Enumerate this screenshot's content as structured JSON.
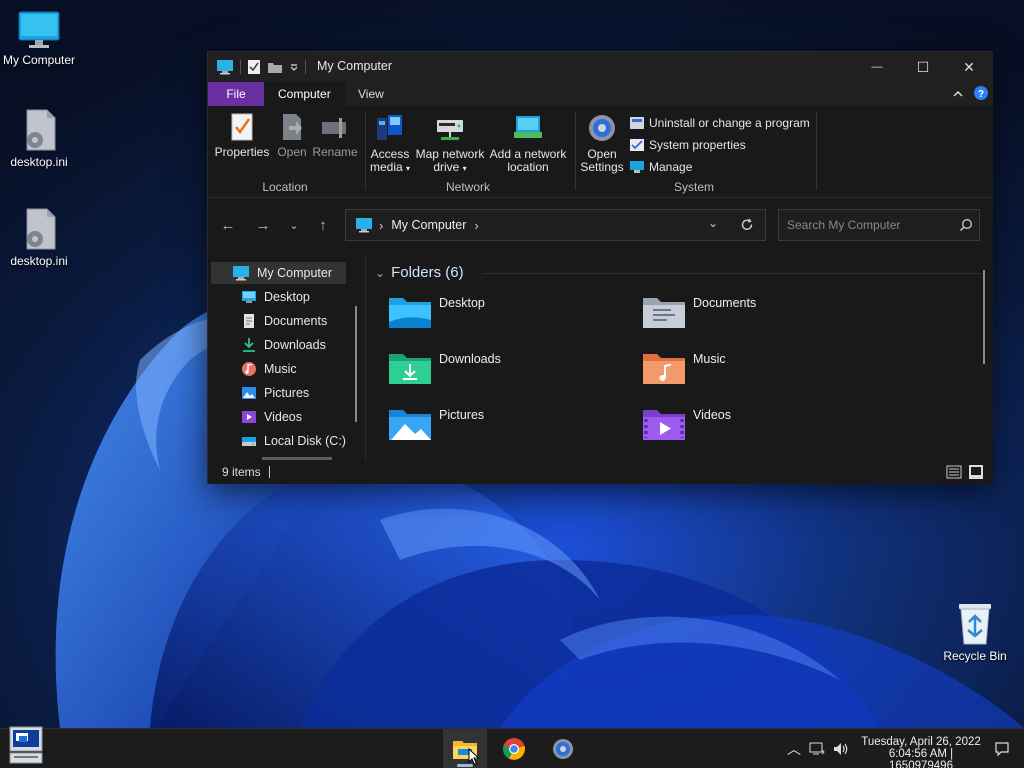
{
  "desktop": {
    "icons": [
      {
        "label": "My Computer",
        "icon": "monitor-icon"
      },
      {
        "label": "desktop.ini",
        "icon": "settings-file-icon"
      },
      {
        "label": "desktop.ini",
        "icon": "settings-file-icon"
      },
      {
        "label": "Recycle Bin",
        "icon": "recycle-bin-icon"
      }
    ]
  },
  "window": {
    "title": "My Computer",
    "controls": {
      "minimize": "—",
      "maximize": "☐",
      "close": "✕"
    },
    "ribbon_tabs": [
      "File",
      "Computer",
      "View"
    ],
    "active_tab": "Computer",
    "ribbon": {
      "location": {
        "label": "Location",
        "buttons": [
          "Properties",
          "Open",
          "Rename"
        ]
      },
      "network": {
        "label": "Network",
        "access_media": [
          "Access",
          "media"
        ],
        "map_network": [
          "Map network",
          "drive"
        ],
        "add_location": [
          "Add a network",
          "location"
        ]
      },
      "system": {
        "label": "System",
        "open_settings": [
          "Open",
          "Settings"
        ],
        "items": [
          "Uninstall or change a program",
          "System properties",
          "Manage"
        ]
      }
    },
    "address": {
      "path": "My Computer",
      "search_placeholder": "Search My Computer"
    },
    "nav_pane": {
      "items": [
        {
          "label": "My Computer",
          "icon": "monitor-icon",
          "selected": true
        },
        {
          "label": "Desktop",
          "icon": "desktop-icon"
        },
        {
          "label": "Documents",
          "icon": "documents-icon"
        },
        {
          "label": "Downloads",
          "icon": "download-icon"
        },
        {
          "label": "Music",
          "icon": "music-icon"
        },
        {
          "label": "Pictures",
          "icon": "pictures-icon"
        },
        {
          "label": "Videos",
          "icon": "videos-icon"
        },
        {
          "label": "Local Disk (C:)",
          "icon": "drive-icon"
        }
      ]
    },
    "content": {
      "group_title": "Folders (6)",
      "folders": [
        {
          "label": "Desktop",
          "icon": "desktop-folder-icon"
        },
        {
          "label": "Documents",
          "icon": "documents-folder-icon"
        },
        {
          "label": "Downloads",
          "icon": "downloads-folder-icon"
        },
        {
          "label": "Music",
          "icon": "music-folder-icon"
        },
        {
          "label": "Pictures",
          "icon": "pictures-folder-icon"
        },
        {
          "label": "Videos",
          "icon": "videos-folder-icon"
        }
      ]
    },
    "status": {
      "item_count": "9 items"
    }
  },
  "taskbar": {
    "apps": [
      "file-explorer-icon",
      "chrome-icon",
      "settings-icon"
    ],
    "active_app": "file-explorer-icon",
    "clock": {
      "date": "Tuesday, April 26, 2022",
      "time": "6:04:56 AM | 1650979496"
    }
  },
  "colors": {
    "file_tab": "#6a2fa0",
    "window_bg": "#191919",
    "taskbar_bg": "#1c1c1c",
    "accent_blue": "#2d7ff9"
  }
}
